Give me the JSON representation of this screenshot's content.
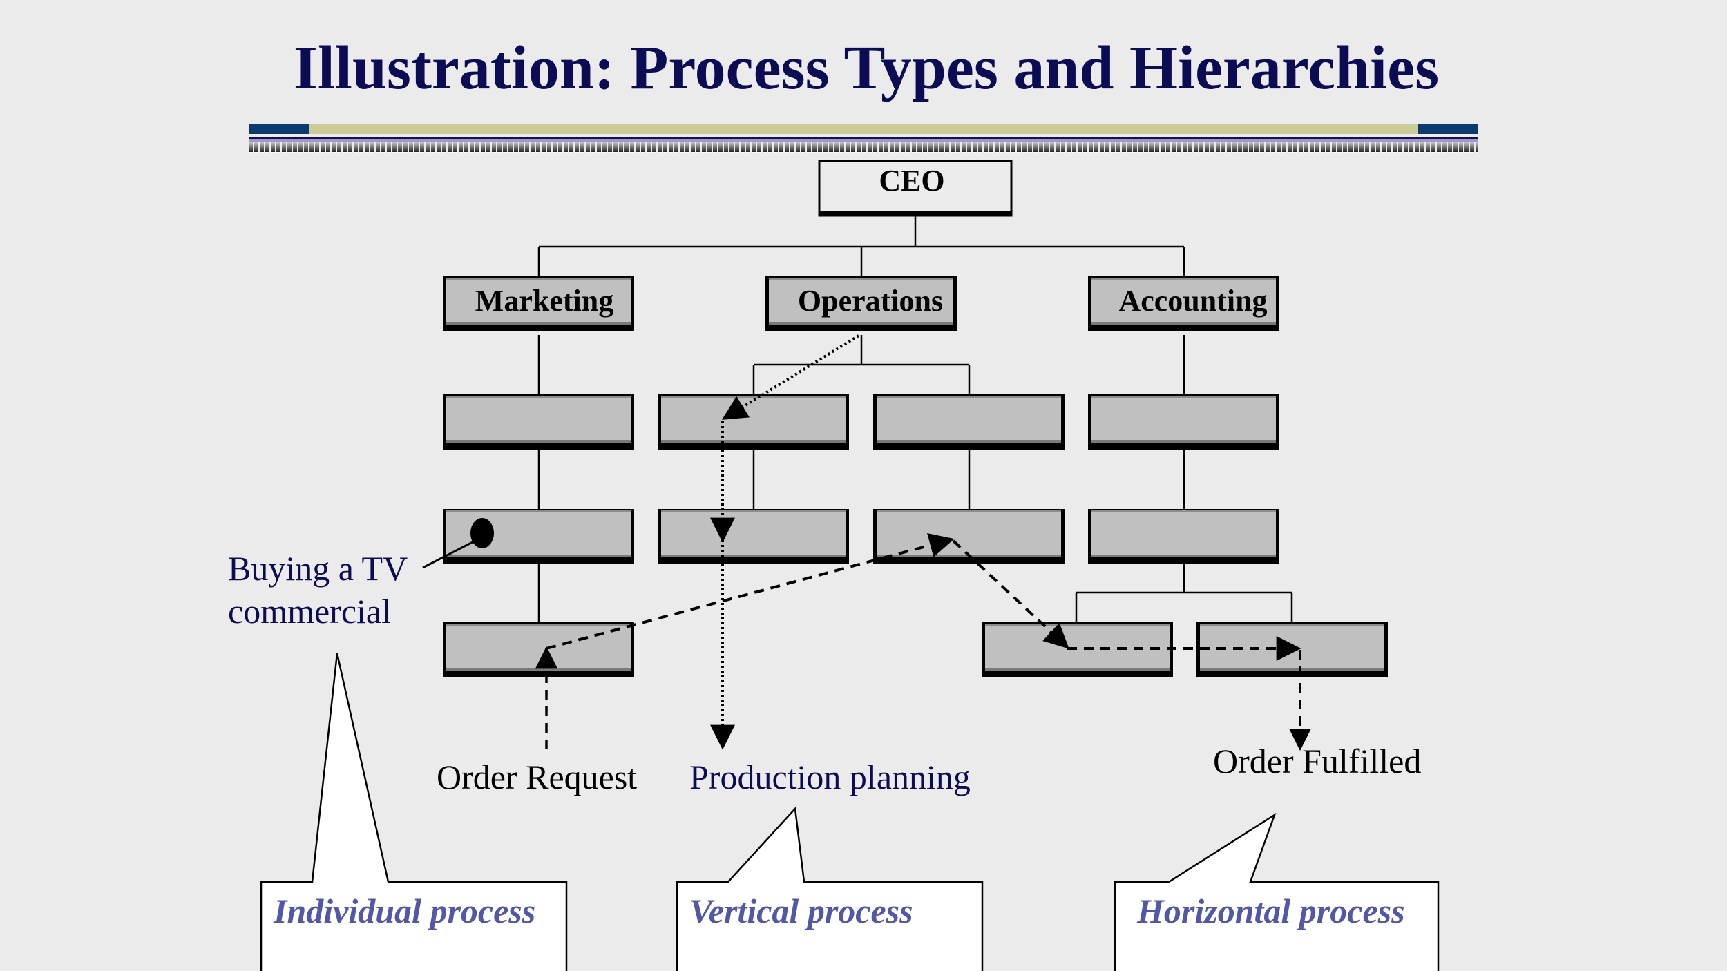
{
  "title": "Illustration: Process Types and Hierarchies",
  "colors": {
    "background": "#ebebeb",
    "title": "#0c0c55",
    "rule_navy": "#0b3a6e",
    "rule_khaki": "#cccc99",
    "box_fill": "#c0c0c0",
    "ceo_fill": "#ececec",
    "annotation_blue": "#0c0c55",
    "callout_text": "#5257a8",
    "callout_fill": "#ffffff"
  },
  "org_chart": {
    "top": {
      "label": "CEO"
    },
    "departments": [
      {
        "label": "Marketing"
      },
      {
        "label": "Operations"
      },
      {
        "label": "Accounting"
      }
    ]
  },
  "annotations": {
    "tv_line1": "Buying a TV",
    "tv_line2": "commercial",
    "order_request": "Order Request",
    "production_planning": "Production planning",
    "order_fulfilled": "Order Fulfilled"
  },
  "callouts": [
    {
      "label": "Individual process"
    },
    {
      "label": "Vertical process"
    },
    {
      "label": "Horizontal process"
    }
  ]
}
